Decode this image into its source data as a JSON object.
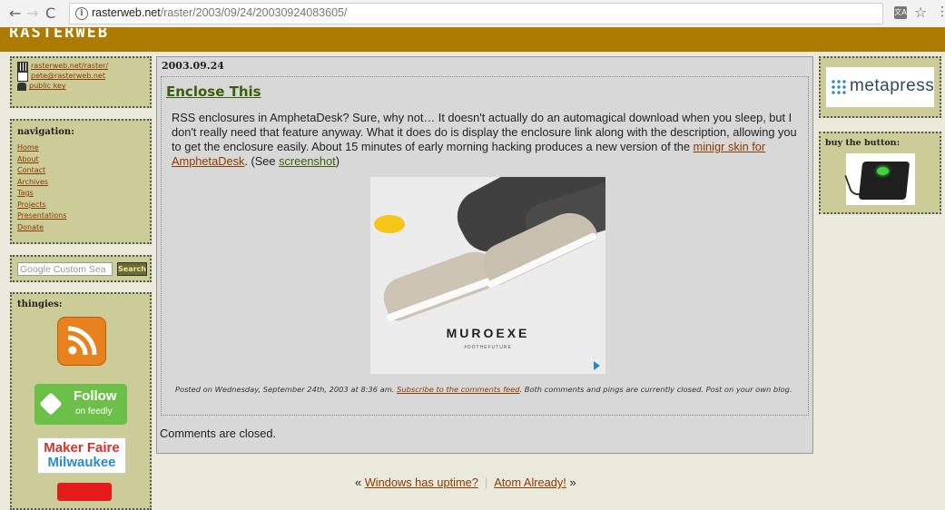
{
  "browser": {
    "url_host": "rasterweb.net",
    "url_path": "/raster/2003/09/24/20030924083605/"
  },
  "site": {
    "logo_text": "RASTERWEB"
  },
  "sidebar": {
    "contact_links": [
      {
        "label": "rasterweb.net/raster/",
        "icon": "home-icon"
      },
      {
        "label": "pete@rasterweb.net",
        "icon": "mail-icon"
      },
      {
        "label": "public key",
        "icon": "key-icon"
      }
    ],
    "nav_heading": "navigation:",
    "nav_items": [
      "Home",
      "About",
      "Contact",
      "Archives",
      "Tags",
      "Projects",
      "Presentations",
      "Donate"
    ],
    "search_placeholder": "Google Custom Sea",
    "search_button": "Search",
    "thingies_heading": "thingies:",
    "feedly_line1": "Follow",
    "feedly_line2": "on feedly",
    "maker_line1": "Maker Faire",
    "maker_line2": "Milwaukee"
  },
  "post": {
    "date": "2003.09.24",
    "title": "Enclose This",
    "body_before": "RSS enclosures in AmphetaDesk? Sure, why not… It doesn't actually do an automagical download when you sleep, but I don't really need that feature anyway. What it does do is display the enclosure link along with the description, allowing you to get the enclosure easily. About 15 minutes of early morning hacking produces a new version of the ",
    "link1": "minigr skin for AmphetaDesk",
    "body_middle": ". (See ",
    "link2": "screenshot",
    "body_after": ")",
    "ad_brand": "MUROEXE",
    "ad_tagline": "#DOTHEFUTURE",
    "posted_before": "Posted on Wednesday, September 24th, 2003 at 8:36 am. ",
    "posted_link": "Subscribe to the comments feed",
    "posted_after": ". Both comments and pings are currently closed. Post on your own blog.",
    "comments_closed": "Comments are closed."
  },
  "pager": {
    "prev_prefix": "«",
    "prev_label": "Windows has uptime?",
    "next_label": "Atom Already!",
    "next_suffix": "»"
  },
  "right": {
    "metapress": "metapress",
    "buy_title": "buy the button:"
  },
  "colors": {
    "banner": "#ad7b00",
    "sidebar_bg": "#cccc99",
    "link_brown": "#8b3a00",
    "title_green": "#3a5f0b"
  }
}
